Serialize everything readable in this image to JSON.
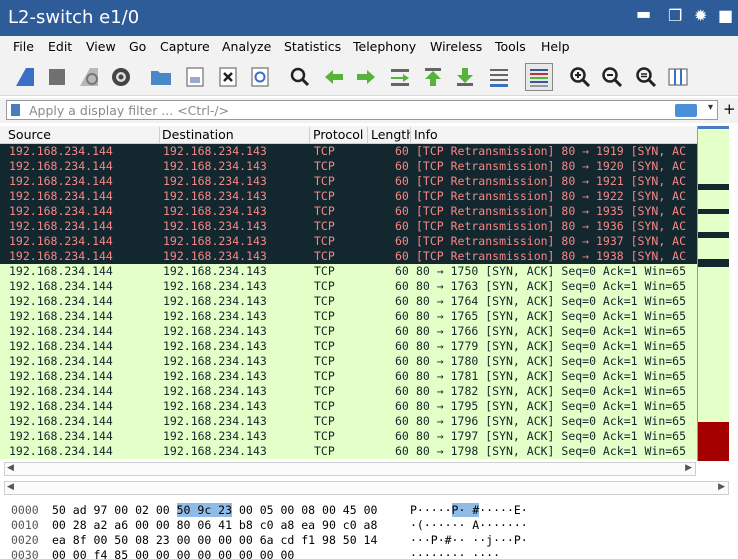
{
  "window": {
    "title": "L2-switch e1/0",
    "controls": [
      "minimize-icon",
      "restore-icon",
      "settings-gear-icon",
      "close-icon"
    ]
  },
  "menu": [
    "File",
    "Edit",
    "View",
    "Go",
    "Capture",
    "Analyze",
    "Statistics",
    "Telephony",
    "Wireless",
    "Tools",
    "Help"
  ],
  "toolbar_icons": [
    "shark-fin-start-icon",
    "stop-icon",
    "restart-icon",
    "capture-options-gear-icon",
    "open-folder-icon",
    "save-file-icon",
    "close-file-icon",
    "reload-icon",
    "find-packet-icon",
    "back-arrow-icon",
    "forward-arrow-icon",
    "go-to-packet-icon",
    "first-packet-icon",
    "last-packet-icon",
    "autoscroll-icon",
    "colorize-icon",
    "zoom-in-icon",
    "zoom-out-icon",
    "normal-size-icon",
    "resize-columns-icon"
  ],
  "filter": {
    "placeholder": "Apply a display filter ... <Ctrl-/>",
    "add_button": "+"
  },
  "columns": {
    "source": "Source",
    "destination": "Destination",
    "protocol": "Protocol",
    "length": "Length",
    "info": "Info"
  },
  "packets": [
    {
      "src": "192.168.234.144",
      "dst": "192.168.234.143",
      "proto": "TCP",
      "len": "60",
      "info": "[TCP Retransmission] 80 → 1919 [SYN, AC",
      "style": "retrans"
    },
    {
      "src": "192.168.234.144",
      "dst": "192.168.234.143",
      "proto": "TCP",
      "len": "60",
      "info": "[TCP Retransmission] 80 → 1920 [SYN, AC",
      "style": "retrans"
    },
    {
      "src": "192.168.234.144",
      "dst": "192.168.234.143",
      "proto": "TCP",
      "len": "60",
      "info": "[TCP Retransmission] 80 → 1921 [SYN, AC",
      "style": "retrans"
    },
    {
      "src": "192.168.234.144",
      "dst": "192.168.234.143",
      "proto": "TCP",
      "len": "60",
      "info": "[TCP Retransmission] 80 → 1922 [SYN, AC",
      "style": "retrans"
    },
    {
      "src": "192.168.234.144",
      "dst": "192.168.234.143",
      "proto": "TCP",
      "len": "60",
      "info": "[TCP Retransmission] 80 → 1935 [SYN, AC",
      "style": "retrans"
    },
    {
      "src": "192.168.234.144",
      "dst": "192.168.234.143",
      "proto": "TCP",
      "len": "60",
      "info": "[TCP Retransmission] 80 → 1936 [SYN, AC",
      "style": "retrans"
    },
    {
      "src": "192.168.234.144",
      "dst": "192.168.234.143",
      "proto": "TCP",
      "len": "60",
      "info": "[TCP Retransmission] 80 → 1937 [SYN, AC",
      "style": "retrans"
    },
    {
      "src": "192.168.234.144",
      "dst": "192.168.234.143",
      "proto": "TCP",
      "len": "60",
      "info": "[TCP Retransmission] 80 → 1938 [SYN, AC",
      "style": "retrans"
    },
    {
      "src": "192.168.234.144",
      "dst": "192.168.234.143",
      "proto": "TCP",
      "len": "60",
      "info": "80 → 1750 [SYN, ACK] Seq=0 Ack=1 Win=65",
      "style": "synack"
    },
    {
      "src": "192.168.234.144",
      "dst": "192.168.234.143",
      "proto": "TCP",
      "len": "60",
      "info": "80 → 1763 [SYN, ACK] Seq=0 Ack=1 Win=65",
      "style": "synack"
    },
    {
      "src": "192.168.234.144",
      "dst": "192.168.234.143",
      "proto": "TCP",
      "len": "60",
      "info": "80 → 1764 [SYN, ACK] Seq=0 Ack=1 Win=65",
      "style": "synack"
    },
    {
      "src": "192.168.234.144",
      "dst": "192.168.234.143",
      "proto": "TCP",
      "len": "60",
      "info": "80 → 1765 [SYN, ACK] Seq=0 Ack=1 Win=65",
      "style": "synack"
    },
    {
      "src": "192.168.234.144",
      "dst": "192.168.234.143",
      "proto": "TCP",
      "len": "60",
      "info": "80 → 1766 [SYN, ACK] Seq=0 Ack=1 Win=65",
      "style": "synack"
    },
    {
      "src": "192.168.234.144",
      "dst": "192.168.234.143",
      "proto": "TCP",
      "len": "60",
      "info": "80 → 1779 [SYN, ACK] Seq=0 Ack=1 Win=65",
      "style": "synack"
    },
    {
      "src": "192.168.234.144",
      "dst": "192.168.234.143",
      "proto": "TCP",
      "len": "60",
      "info": "80 → 1780 [SYN, ACK] Seq=0 Ack=1 Win=65",
      "style": "synack"
    },
    {
      "src": "192.168.234.144",
      "dst": "192.168.234.143",
      "proto": "TCP",
      "len": "60",
      "info": "80 → 1781 [SYN, ACK] Seq=0 Ack=1 Win=65",
      "style": "synack"
    },
    {
      "src": "192.168.234.144",
      "dst": "192.168.234.143",
      "proto": "TCP",
      "len": "60",
      "info": "80 → 1782 [SYN, ACK] Seq=0 Ack=1 Win=65",
      "style": "synack"
    },
    {
      "src": "192.168.234.144",
      "dst": "192.168.234.143",
      "proto": "TCP",
      "len": "60",
      "info": "80 → 1795 [SYN, ACK] Seq=0 Ack=1 Win=65",
      "style": "synack"
    },
    {
      "src": "192.168.234.144",
      "dst": "192.168.234.143",
      "proto": "TCP",
      "len": "60",
      "info": "80 → 1796 [SYN, ACK] Seq=0 Ack=1 Win=65",
      "style": "synack"
    },
    {
      "src": "192.168.234.144",
      "dst": "192.168.234.143",
      "proto": "TCP",
      "len": "60",
      "info": "80 → 1797 [SYN, ACK] Seq=0 Ack=1 Win=65",
      "style": "synack"
    },
    {
      "src": "192.168.234.144",
      "dst": "192.168.234.143",
      "proto": "TCP",
      "len": "60",
      "info": "80 → 1798 [SYN, ACK] Seq=0 Ack=1 Win=65",
      "style": "synack"
    }
  ],
  "colors": {
    "titlebar": "#2e5c99",
    "retrans_bg": "#12272e",
    "retrans_fg": "#f78787",
    "synack_bg": "#e4ffc7",
    "synack_fg": "#12272e",
    "hex_highlight": "#8fbce6",
    "minimap_red": "#a40000"
  },
  "hex_dump": [
    {
      "offset": "0000",
      "pre": "50 ad 97 00 02 00 ",
      "hl": "50 9c  23",
      "post": " 00 05 00 08 00 45 00",
      "ascii_pre": "P·····",
      "ascii_hl": "P· #",
      "ascii_post": "·····E·"
    },
    {
      "offset": "0010",
      "pre": "00 28 a2 a6 00 00 80 06  41 b8 c0 a8 ea 90 c0 a8",
      "hl": "",
      "post": "",
      "ascii_pre": "·(······ A·······",
      "ascii_hl": "",
      "ascii_post": ""
    },
    {
      "offset": "0020",
      "pre": "ea 8f 00 50 08 23 00 00  00 00 6a cd f1 98 50 14",
      "hl": "",
      "post": "",
      "ascii_pre": "···P·#·· ··j···P·",
      "ascii_hl": "",
      "ascii_post": ""
    },
    {
      "offset": "0030",
      "pre": "00 00 f4 85 00 00 00 00  00 00 00 00",
      "hl": "",
      "post": "",
      "ascii_pre": "········ ····",
      "ascii_hl": "",
      "ascii_post": ""
    }
  ]
}
